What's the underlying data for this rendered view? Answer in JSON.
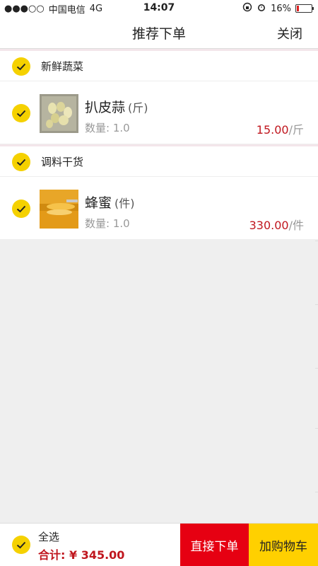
{
  "status_bar": {
    "signal": "●●●○○",
    "carrier": "中国电信",
    "network": "4G",
    "time": "14:07",
    "battery": "16%",
    "battery_level": 0.16
  },
  "nav": {
    "title": "推荐下单",
    "close_label": "关闭"
  },
  "groups": [
    {
      "name": "新鲜蔬菜",
      "items": [
        {
          "name": "扒皮蒜",
          "unit": "(斤)",
          "qty_label": "数量:",
          "qty": "1.0",
          "price": "15.00",
          "price_unit": "/斤"
        }
      ]
    },
    {
      "name": "调料干货",
      "items": [
        {
          "name": "蜂蜜",
          "unit": "(件)",
          "qty_label": "数量:",
          "qty": "1.0",
          "price": "330.00",
          "price_unit": "/件"
        }
      ]
    }
  ],
  "footer": {
    "select_all_label": "全选",
    "total_label": "合计:",
    "total_value": "¥ 345.00",
    "direct_order_label": "直接下单",
    "add_cart_label": "加购物车"
  },
  "colors": {
    "accent_yellow": "#f5d100",
    "price_red": "#c0161e",
    "button_red": "#e60012",
    "button_yellow": "#ffd000"
  }
}
